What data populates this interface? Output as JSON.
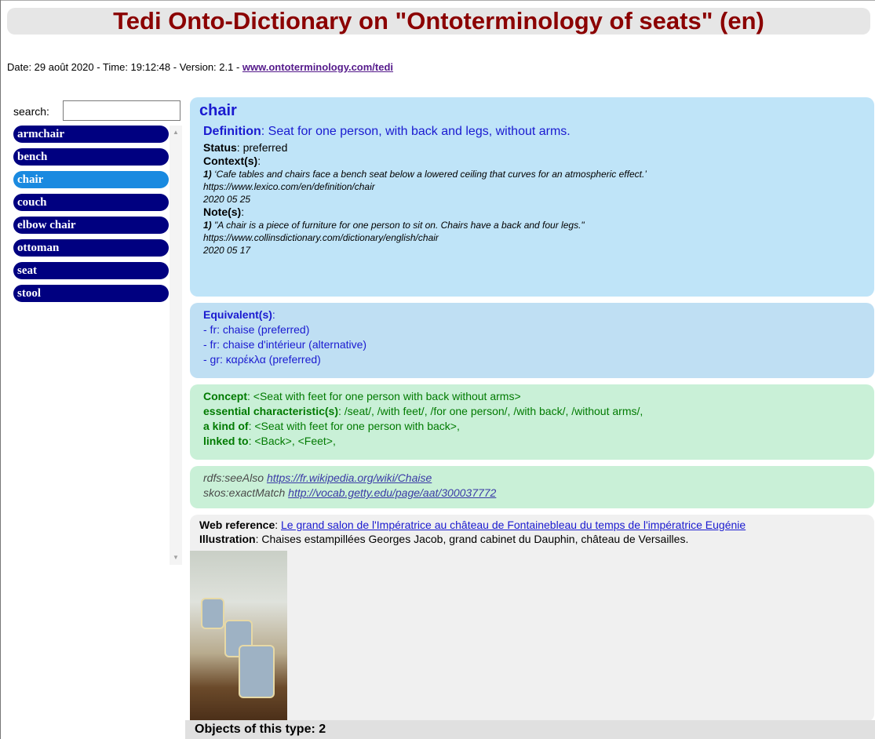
{
  "header": {
    "title": "Tedi Onto-Dictionary on \"Ontoterminology of seats\" (en)",
    "meta_prefix": "Date: 29 août 2020 - Time: 19:12:48 - Version: 2.1 - ",
    "site_link": "www.ontoterminology.com/tedi"
  },
  "sidebar": {
    "search_label": "search:",
    "search_value": "",
    "items": [
      {
        "label": "armchair",
        "selected": false
      },
      {
        "label": "bench",
        "selected": false
      },
      {
        "label": "chair",
        "selected": true
      },
      {
        "label": "couch",
        "selected": false
      },
      {
        "label": "elbow chair",
        "selected": false
      },
      {
        "label": "ottoman",
        "selected": false
      },
      {
        "label": "seat",
        "selected": false
      },
      {
        "label": "stool",
        "selected": false
      }
    ]
  },
  "entry": {
    "term": "chair",
    "definition_label": "Definition",
    "definition_text": ": Seat for one person, with back and legs, without arms.",
    "status_label": "Status",
    "status_value": ": preferred",
    "contexts_label": "Context(s)",
    "contexts_colon": ":",
    "context_num": "1)",
    "context_text": " ‘Cafe tables and chairs face a bench seat below a lowered ceiling that curves for an atmospheric effect.’",
    "context_source": "https://www.lexico.com/en/definition/chair",
    "context_date": "2020 05 25",
    "notes_label": "Note(s)",
    "notes_colon": ":",
    "note_num": "1)",
    "note_text": " \"A chair is a piece of furniture for one person to sit on. Chairs have a back and four legs.\"",
    "note_source": "https://www.collinsdictionary.com/dictionary/english/chair",
    "note_date": "2020 05 17"
  },
  "equivalents": {
    "label": "Equivalent(s)",
    "colon": ":",
    "items": [
      "- fr: chaise (preferred)",
      "- fr: chaise d'intérieur (alternative)",
      "- gr: καρέκλα (preferred)"
    ]
  },
  "concept": {
    "concept_label": "Concept",
    "concept_value": ": <Seat with feet for one person with back without arms>",
    "essential_label": "essential characteristic(s)",
    "essential_value": ": /seat/, /with feet/, /for one person/, /with back/, /without arms/,",
    "kindof_label": "a kind of",
    "kindof_value": ": <Seat with feet for one person with back>,",
    "linked_label": "linked to",
    "linked_value": ": <Back>, <Feet>,"
  },
  "links": {
    "see_also_label": "rdfs:seeAlso ",
    "see_also_url": "https://fr.wikipedia.org/wiki/Chaise",
    "exact_label": "skos:exactMatch ",
    "exact_url": "http://vocab.getty.edu/page/aat/300037772"
  },
  "reference": {
    "web_label": "Web reference",
    "web_colon": ": ",
    "web_link": "Le grand salon de l'Impératrice au château de Fontainebleau du temps de l'impératrice Eugénie",
    "illustration_label": "Illustration",
    "illustration_text": ": Chaises estampillées Georges Jacob, grand cabinet du Dauphin, château de Versailles."
  },
  "footer": {
    "objects_label": "Objects of this type: 2"
  },
  "colors": {
    "title": "#8b0000",
    "list_item": "#000080",
    "list_selected": "#1a8ae0",
    "entry_panel": "#bfe4f8",
    "concept_panel": "#c9f0d7"
  }
}
